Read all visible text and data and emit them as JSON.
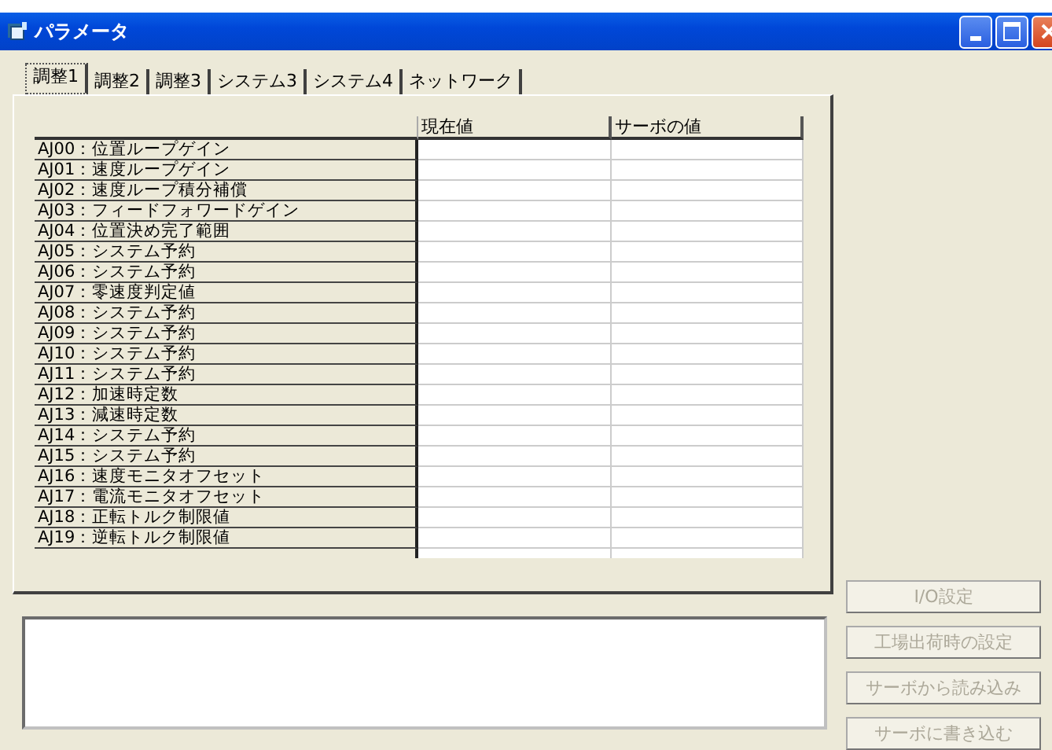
{
  "window": {
    "title": "パラメータ"
  },
  "tabs": [
    {
      "label": "調整1",
      "selected": true
    },
    {
      "label": "調整2",
      "selected": false
    },
    {
      "label": "調整3",
      "selected": false
    },
    {
      "label": "システム3",
      "selected": false
    },
    {
      "label": "システム4",
      "selected": false
    },
    {
      "label": "ネットワーク",
      "selected": false
    }
  ],
  "table": {
    "columns": [
      "現在値",
      "サーボの値"
    ],
    "rows": [
      {
        "name": "AJ00：位置ループゲイン"
      },
      {
        "name": "AJ01：速度ループゲイン"
      },
      {
        "name": "AJ02：速度ループ積分補償"
      },
      {
        "name": "AJ03：フィードフォワードゲイン"
      },
      {
        "name": "AJ04：位置決め完了範囲"
      },
      {
        "name": "AJ05：システム予約"
      },
      {
        "name": "AJ06：システム予約"
      },
      {
        "name": "AJ07：零速度判定値"
      },
      {
        "name": "AJ08：システム予約"
      },
      {
        "name": "AJ09：システム予約"
      },
      {
        "name": "AJ10：システム予約"
      },
      {
        "name": "AJ11：システム予約"
      },
      {
        "name": "AJ12：加速時定数"
      },
      {
        "name": "AJ13：減速時定数"
      },
      {
        "name": "AJ14：システム予約"
      },
      {
        "name": "AJ15：システム予約"
      },
      {
        "name": "AJ16：速度モニタオフセット"
      },
      {
        "name": "AJ17：電流モニタオフセット"
      },
      {
        "name": "AJ18：正転トルク制限値"
      },
      {
        "name": "AJ19：逆転トルク制限値"
      }
    ]
  },
  "buttons": [
    {
      "label": "I/O設定",
      "disabled": true
    },
    {
      "label": "工場出荷時の設定",
      "disabled": true
    },
    {
      "label": "サーボから読み込み",
      "disabled": true
    },
    {
      "label": "サーボに書き込む",
      "disabled": true
    }
  ]
}
